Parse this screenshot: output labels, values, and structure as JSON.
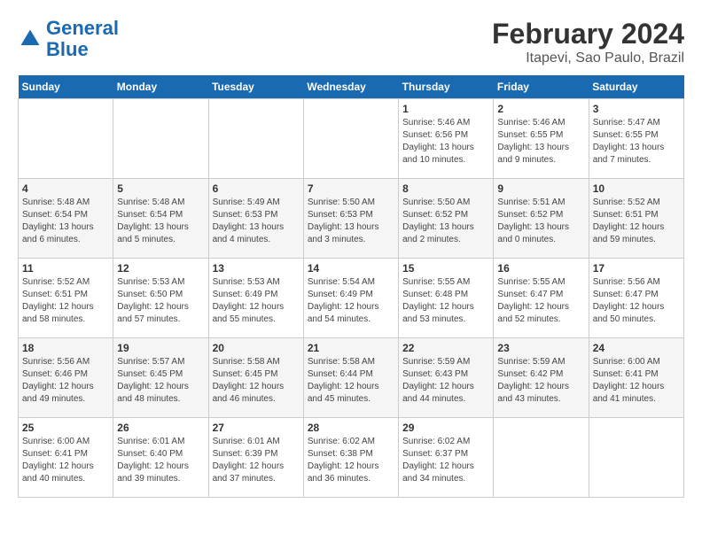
{
  "logo": {
    "line1": "General",
    "line2": "Blue"
  },
  "title": "February 2024",
  "subtitle": "Itapevi, Sao Paulo, Brazil",
  "weekdays": [
    "Sunday",
    "Monday",
    "Tuesday",
    "Wednesday",
    "Thursday",
    "Friday",
    "Saturday"
  ],
  "weeks": [
    [
      {
        "day": "",
        "info": ""
      },
      {
        "day": "",
        "info": ""
      },
      {
        "day": "",
        "info": ""
      },
      {
        "day": "",
        "info": ""
      },
      {
        "day": "1",
        "info": "Sunrise: 5:46 AM\nSunset: 6:56 PM\nDaylight: 13 hours and 10 minutes."
      },
      {
        "day": "2",
        "info": "Sunrise: 5:46 AM\nSunset: 6:55 PM\nDaylight: 13 hours and 9 minutes."
      },
      {
        "day": "3",
        "info": "Sunrise: 5:47 AM\nSunset: 6:55 PM\nDaylight: 13 hours and 7 minutes."
      }
    ],
    [
      {
        "day": "4",
        "info": "Sunrise: 5:48 AM\nSunset: 6:54 PM\nDaylight: 13 hours and 6 minutes."
      },
      {
        "day": "5",
        "info": "Sunrise: 5:48 AM\nSunset: 6:54 PM\nDaylight: 13 hours and 5 minutes."
      },
      {
        "day": "6",
        "info": "Sunrise: 5:49 AM\nSunset: 6:53 PM\nDaylight: 13 hours and 4 minutes."
      },
      {
        "day": "7",
        "info": "Sunrise: 5:50 AM\nSunset: 6:53 PM\nDaylight: 13 hours and 3 minutes."
      },
      {
        "day": "8",
        "info": "Sunrise: 5:50 AM\nSunset: 6:52 PM\nDaylight: 13 hours and 2 minutes."
      },
      {
        "day": "9",
        "info": "Sunrise: 5:51 AM\nSunset: 6:52 PM\nDaylight: 13 hours and 0 minutes."
      },
      {
        "day": "10",
        "info": "Sunrise: 5:52 AM\nSunset: 6:51 PM\nDaylight: 12 hours and 59 minutes."
      }
    ],
    [
      {
        "day": "11",
        "info": "Sunrise: 5:52 AM\nSunset: 6:51 PM\nDaylight: 12 hours and 58 minutes."
      },
      {
        "day": "12",
        "info": "Sunrise: 5:53 AM\nSunset: 6:50 PM\nDaylight: 12 hours and 57 minutes."
      },
      {
        "day": "13",
        "info": "Sunrise: 5:53 AM\nSunset: 6:49 PM\nDaylight: 12 hours and 55 minutes."
      },
      {
        "day": "14",
        "info": "Sunrise: 5:54 AM\nSunset: 6:49 PM\nDaylight: 12 hours and 54 minutes."
      },
      {
        "day": "15",
        "info": "Sunrise: 5:55 AM\nSunset: 6:48 PM\nDaylight: 12 hours and 53 minutes."
      },
      {
        "day": "16",
        "info": "Sunrise: 5:55 AM\nSunset: 6:47 PM\nDaylight: 12 hours and 52 minutes."
      },
      {
        "day": "17",
        "info": "Sunrise: 5:56 AM\nSunset: 6:47 PM\nDaylight: 12 hours and 50 minutes."
      }
    ],
    [
      {
        "day": "18",
        "info": "Sunrise: 5:56 AM\nSunset: 6:46 PM\nDaylight: 12 hours and 49 minutes."
      },
      {
        "day": "19",
        "info": "Sunrise: 5:57 AM\nSunset: 6:45 PM\nDaylight: 12 hours and 48 minutes."
      },
      {
        "day": "20",
        "info": "Sunrise: 5:58 AM\nSunset: 6:45 PM\nDaylight: 12 hours and 46 minutes."
      },
      {
        "day": "21",
        "info": "Sunrise: 5:58 AM\nSunset: 6:44 PM\nDaylight: 12 hours and 45 minutes."
      },
      {
        "day": "22",
        "info": "Sunrise: 5:59 AM\nSunset: 6:43 PM\nDaylight: 12 hours and 44 minutes."
      },
      {
        "day": "23",
        "info": "Sunrise: 5:59 AM\nSunset: 6:42 PM\nDaylight: 12 hours and 43 minutes."
      },
      {
        "day": "24",
        "info": "Sunrise: 6:00 AM\nSunset: 6:41 PM\nDaylight: 12 hours and 41 minutes."
      }
    ],
    [
      {
        "day": "25",
        "info": "Sunrise: 6:00 AM\nSunset: 6:41 PM\nDaylight: 12 hours and 40 minutes."
      },
      {
        "day": "26",
        "info": "Sunrise: 6:01 AM\nSunset: 6:40 PM\nDaylight: 12 hours and 39 minutes."
      },
      {
        "day": "27",
        "info": "Sunrise: 6:01 AM\nSunset: 6:39 PM\nDaylight: 12 hours and 37 minutes."
      },
      {
        "day": "28",
        "info": "Sunrise: 6:02 AM\nSunset: 6:38 PM\nDaylight: 12 hours and 36 minutes."
      },
      {
        "day": "29",
        "info": "Sunrise: 6:02 AM\nSunset: 6:37 PM\nDaylight: 12 hours and 34 minutes."
      },
      {
        "day": "",
        "info": ""
      },
      {
        "day": "",
        "info": ""
      }
    ]
  ]
}
